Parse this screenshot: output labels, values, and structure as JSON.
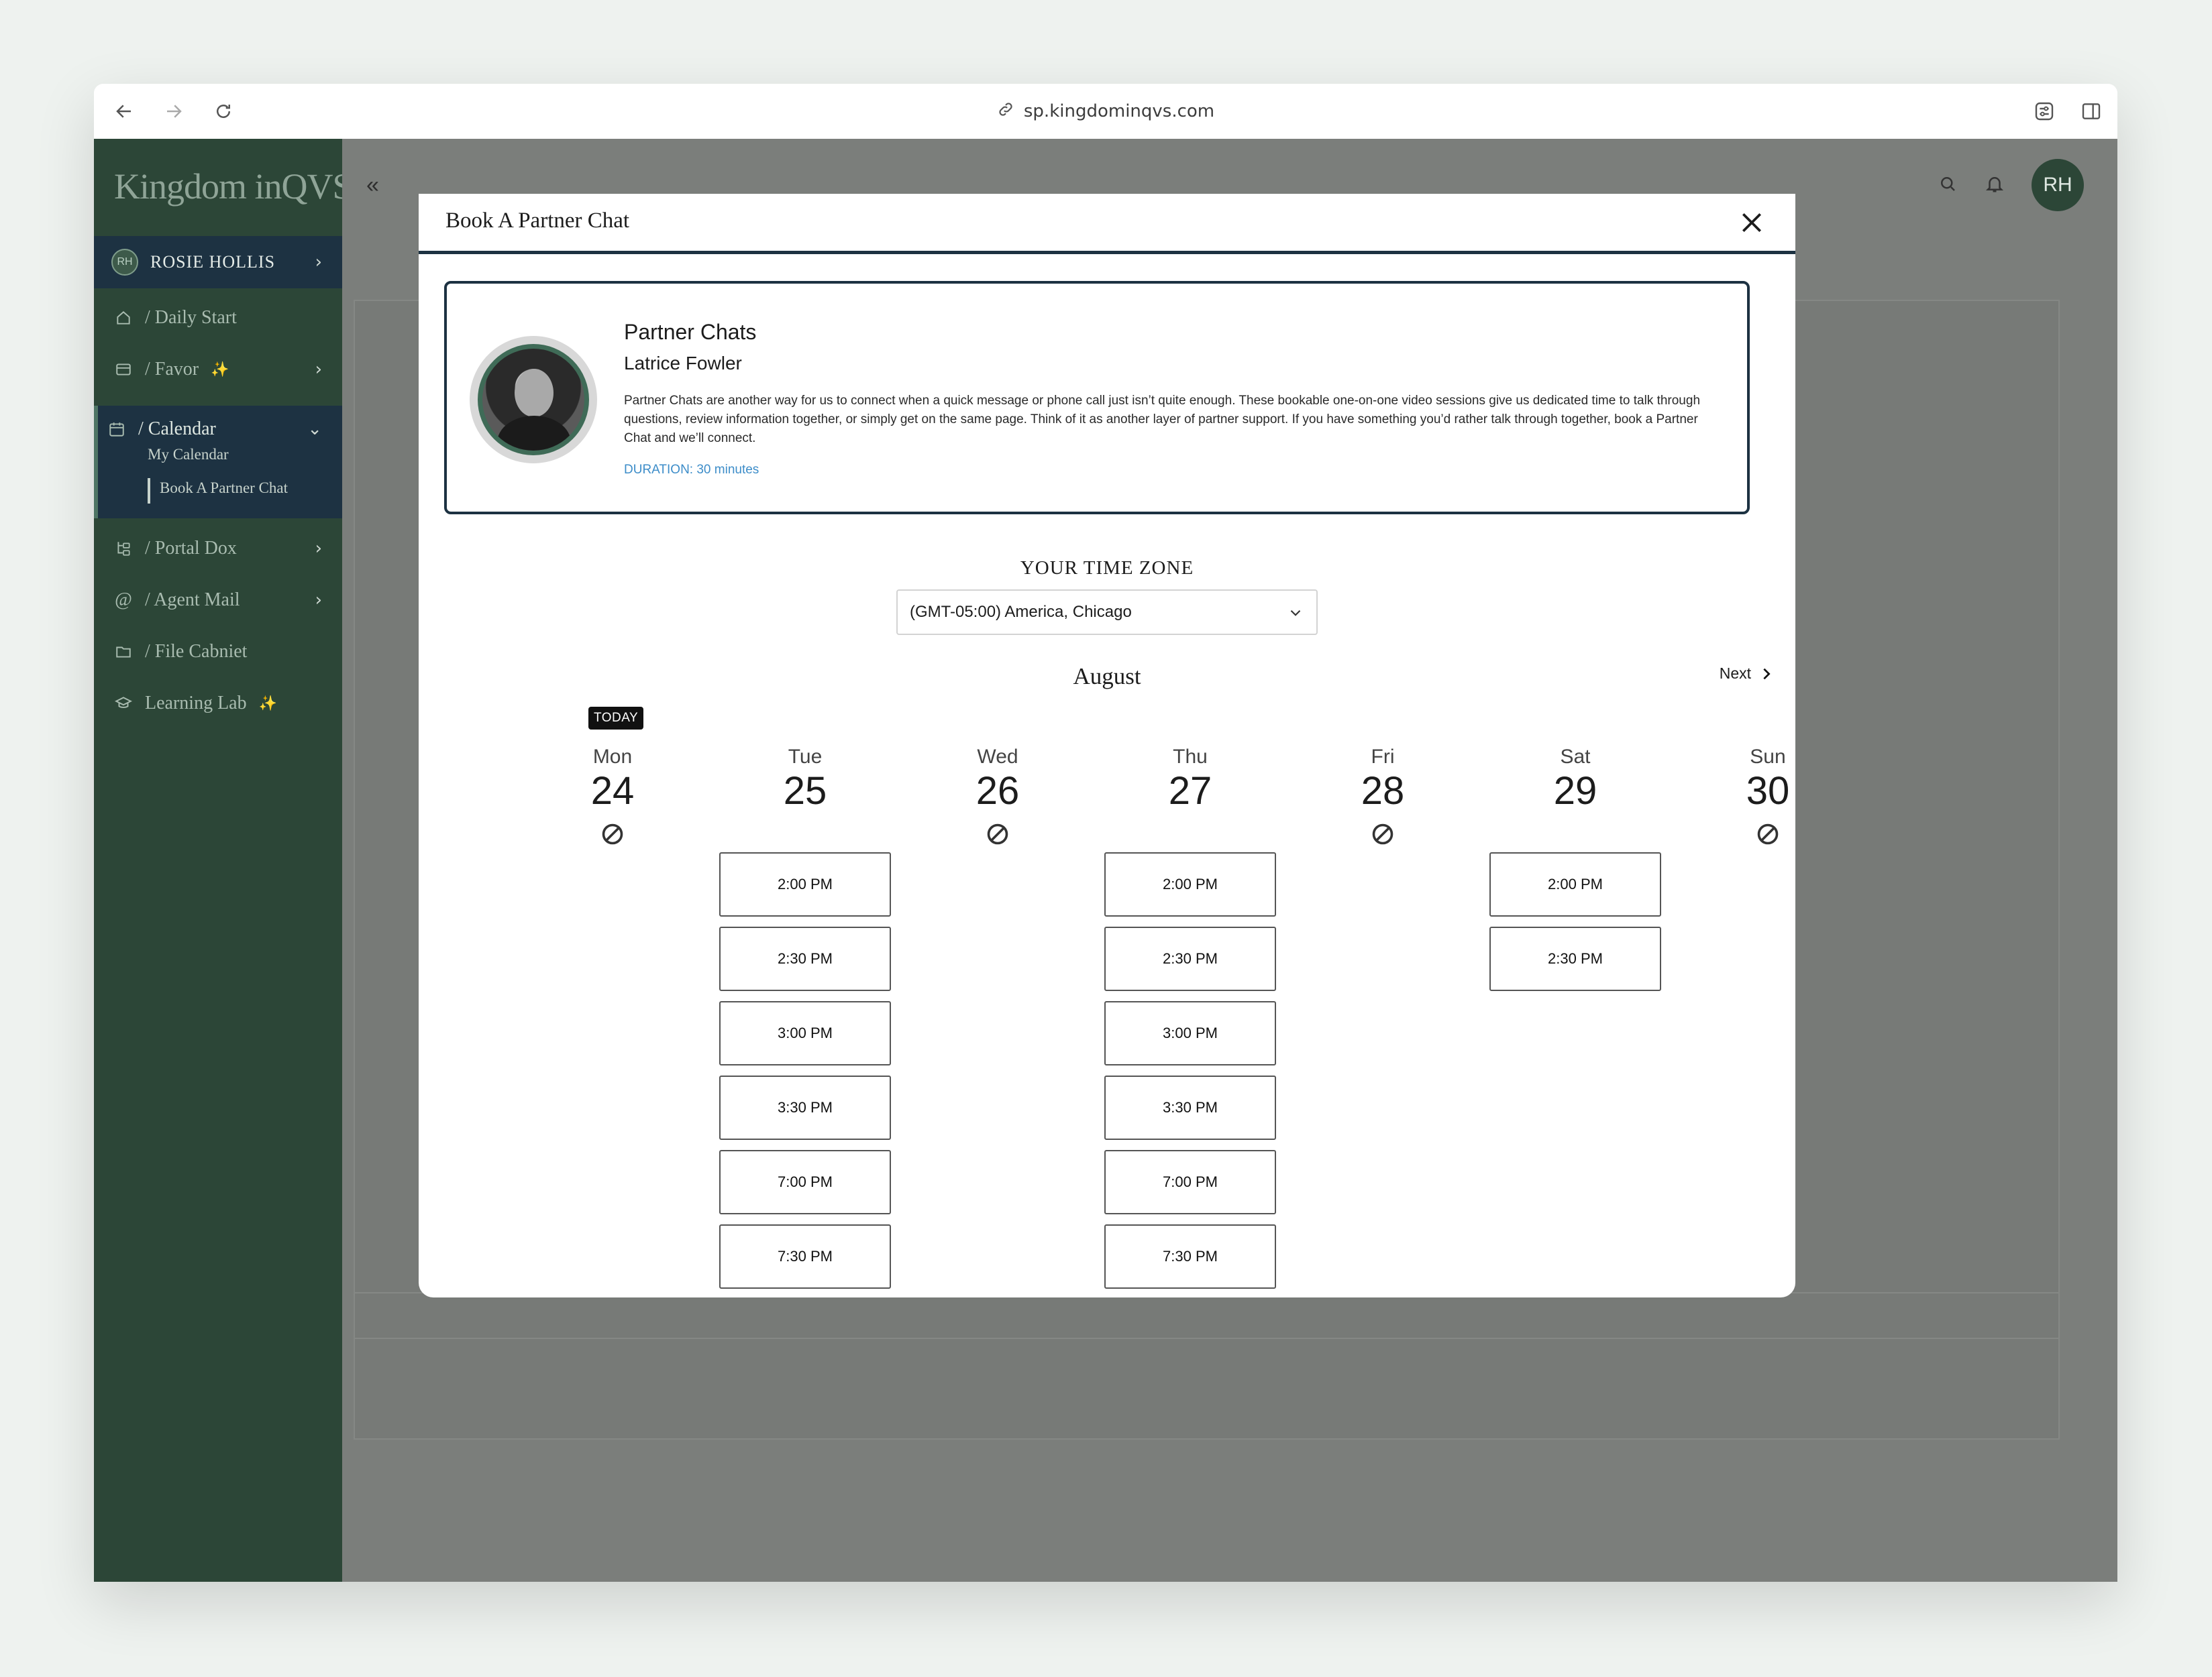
{
  "browser": {
    "url": "sp.kingdominqvs.com"
  },
  "sidebar": {
    "logo": "Kingdom inQVS",
    "user": {
      "initials": "RH",
      "name": "ROSIE HOLLIS"
    },
    "items": [
      {
        "label": "/ Daily Start"
      },
      {
        "label": "/ Favor"
      },
      {
        "label": "/ Calendar"
      },
      {
        "label": "/ Portal Dox"
      },
      {
        "label": "/ Agent Mail"
      },
      {
        "label": "/ File Cabniet"
      },
      {
        "label": "Learning Lab"
      }
    ],
    "calendar_sub": [
      {
        "label": "My Calendar"
      },
      {
        "label": "Book A Partner Chat"
      }
    ],
    "sparkle": "✨"
  },
  "header": {
    "avatar_initials": "RH"
  },
  "modal": {
    "title": "Book A Partner Chat",
    "card": {
      "title": "Partner Chats",
      "name": "Latrice Fowler",
      "description": "Partner Chats are another way for us to connect when a quick message or phone call just isn’t quite enough. These bookable one-on-one video sessions give us dedicated time to talk through questions, review information together, or simply get on the same page. Think of it as another layer of partner support. If you have something you’d rather talk through together, book a Partner Chat and we’ll connect.",
      "duration": "DURATION: 30 minutes"
    },
    "timezone_label": "YOUR TIME ZONE",
    "timezone_value": "(GMT-05:00) America, Chicago",
    "month": "August",
    "next_label": "Next",
    "today_label": "TODAY",
    "days": [
      {
        "dow": "Mon",
        "num": "24",
        "slots": []
      },
      {
        "dow": "Tue",
        "num": "25",
        "slots": [
          "2:00 PM",
          "2:30 PM",
          "3:00 PM",
          "3:30 PM",
          "7:00 PM",
          "7:30 PM"
        ]
      },
      {
        "dow": "Wed",
        "num": "26",
        "slots": []
      },
      {
        "dow": "Thu",
        "num": "27",
        "slots": [
          "2:00 PM",
          "2:30 PM",
          "3:00 PM",
          "3:30 PM",
          "7:00 PM",
          "7:30 PM"
        ]
      },
      {
        "dow": "Fri",
        "num": "28",
        "slots": []
      },
      {
        "dow": "Sat",
        "num": "29",
        "slots": [
          "2:00 PM",
          "2:30 PM"
        ]
      },
      {
        "dow": "Sun",
        "num": "30",
        "slots": []
      }
    ]
  }
}
